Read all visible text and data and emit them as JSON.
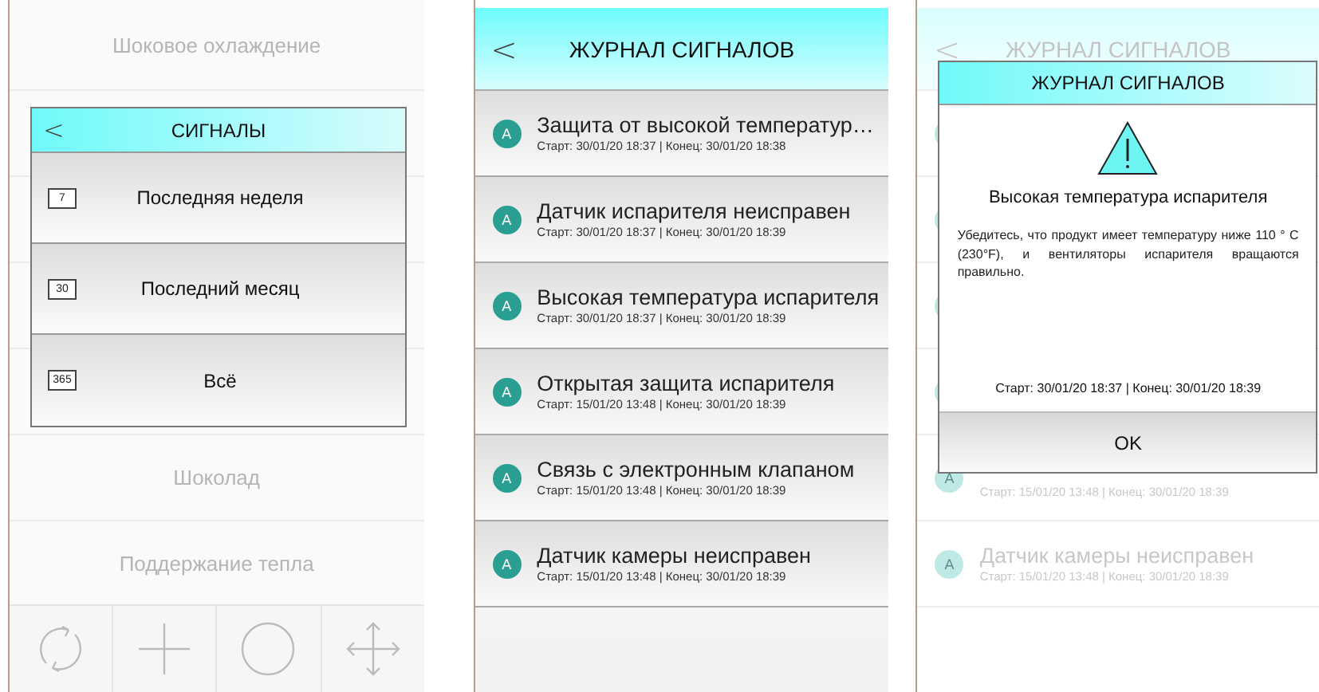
{
  "screens": [
    {
      "kind": "menu",
      "rows": [
        {
          "kind": "item",
          "label": "Шоковое охлаждение"
        },
        {
          "kind": "covered"
        },
        {
          "kind": "covered"
        },
        {
          "kind": "covered"
        },
        {
          "kind": "covered"
        },
        {
          "kind": "item",
          "label": "Шоколад"
        },
        {
          "kind": "item",
          "label": "Поддержание тепла"
        }
      ],
      "toolbar": [
        {
          "kind": "refresh"
        },
        {
          "kind": "plus"
        },
        {
          "kind": "circle"
        },
        {
          "kind": "move"
        }
      ],
      "dialog": {
        "back": "<",
        "title": "СИГНАЛЫ",
        "options": [
          {
            "icon_label": "7",
            "label": "Последняя неделя"
          },
          {
            "icon_label": "30",
            "label": "Последний месяц"
          },
          {
            "icon_label": "365",
            "label": "Всё"
          }
        ]
      }
    },
    {
      "kind": "log",
      "back": "<",
      "title": "ЖУРНАЛ СИГНАЛОВ",
      "rows": [
        {
          "kind": "alarm",
          "avatar": "A",
          "title": "Защита от высокой температур…",
          "times": "Старт: 30/01/20 18:37 | Конец: 30/01/20 18:38"
        },
        {
          "kind": "alarm",
          "avatar": "A",
          "title": "Датчик испарителя неисправен",
          "times": "Старт: 30/01/20 18:37 | Конец: 30/01/20 18:39"
        },
        {
          "kind": "alarm",
          "avatar": "A",
          "title": "Высокая температура испарителя",
          "times": "Старт: 30/01/20 18:37 | Конец: 30/01/20 18:39"
        },
        {
          "kind": "alarm",
          "avatar": "A",
          "title": "Открытая защита испарителя",
          "times": "Старт: 15/01/20 13:48 | Конец: 30/01/20 18:39"
        },
        {
          "kind": "alarm",
          "avatar": "A",
          "title": "Связь с электронным клапаном",
          "times": "Старт: 15/01/20 13:48 | Конец: 30/01/20 18:39"
        },
        {
          "kind": "alarm",
          "avatar": "A",
          "title": "Датчик камеры неисправен",
          "times": "Старт: 15/01/20 13:48 | Конец: 30/01/20 18:39"
        }
      ]
    },
    {
      "kind": "detail",
      "back": "<",
      "title": "ЖУРНАЛ СИГНАЛОВ",
      "rows": [
        {
          "kind": "covered"
        },
        {
          "kind": "covered"
        },
        {
          "kind": "covered"
        },
        {
          "kind": "covered"
        },
        {
          "kind": "partial",
          "avatar": "A",
          "times": "Старт: 15/01/20 13:48 | Конец: 30/01/20 18:39"
        },
        {
          "kind": "alarm",
          "avatar": "A",
          "title": "Датчик камеры неисправен",
          "times": "Старт: 15/01/20 13:48 | Конец: 30/01/20 18:39"
        }
      ],
      "dialog": {
        "title": "ЖУРНАЛ СИГНАЛОВ",
        "heading": "Высокая температура испарителя",
        "message": "Убедитесь, что продукт имеет температуру ниже 110 ° C (230°F), и вентиляторы испарителя вращаются правильно.",
        "times": "Старт: 30/01/20 18:37 | Конец: 30/01/20 18:39",
        "button": "OK"
      }
    }
  ]
}
